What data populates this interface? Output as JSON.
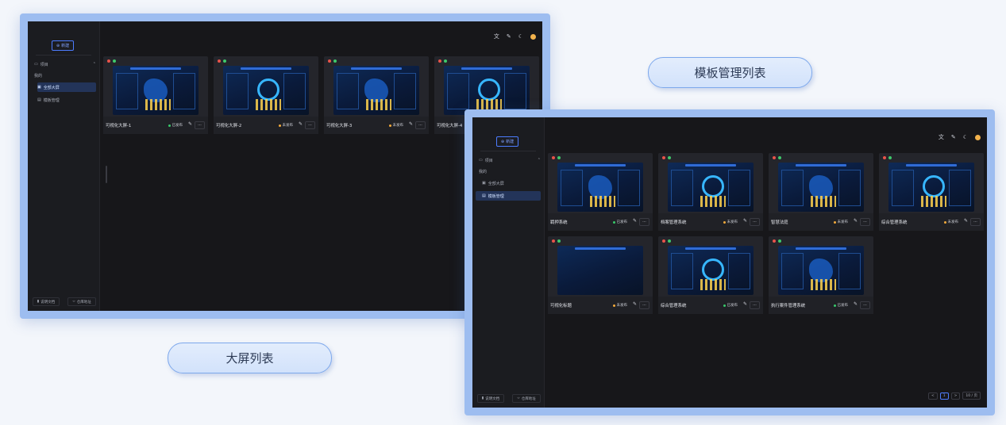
{
  "labels": {
    "template_list": "模板管理列表",
    "screen_list": "大屏列表"
  },
  "sidebar": {
    "new_label": "新建",
    "project_label": "项目",
    "my_label": "我的",
    "items": [
      {
        "label": "全部大屏"
      },
      {
        "label": "模板管理"
      }
    ],
    "docs_label": "说明文档",
    "repo_label": "仓库地址"
  },
  "topbar": {
    "icons": [
      "translate-icon",
      "wrench-icon",
      "moon-icon",
      "avatar"
    ]
  },
  "status_colors": {
    "published": "#37c86a",
    "unpublished": "#f2a93b"
  },
  "screen_list": {
    "selected": "全部大屏",
    "cards": [
      {
        "name": "可视化大屏-1",
        "status": "已发布",
        "state": "published"
      },
      {
        "name": "可视化大屏-2",
        "status": "未发布",
        "state": "unpublished"
      },
      {
        "name": "可视化大屏-3",
        "status": "未发布",
        "state": "unpublished"
      },
      {
        "name": "可视化大屏-4",
        "status": "",
        "state": "unpublished"
      }
    ]
  },
  "template_list": {
    "selected": "模板管理",
    "cards": [
      {
        "name": "羁押系统",
        "status": "已发布",
        "state": "published"
      },
      {
        "name": "档案管理系统",
        "status": "未发布",
        "state": "unpublished"
      },
      {
        "name": "智慧法庭",
        "status": "未发布",
        "state": "unpublished"
      },
      {
        "name": "综合管理系统",
        "status": "未发布",
        "state": "unpublished"
      },
      {
        "name": "可视化标题",
        "status": "未发布",
        "state": "unpublished"
      },
      {
        "name": "综合管理系统",
        "status": "已发布",
        "state": "published"
      },
      {
        "name": "执行案件管理系统",
        "status": "已发布",
        "state": "published"
      }
    ],
    "pagination": {
      "prev": "<",
      "current": "1",
      "next": ">",
      "page_size": "10 / 页"
    }
  }
}
